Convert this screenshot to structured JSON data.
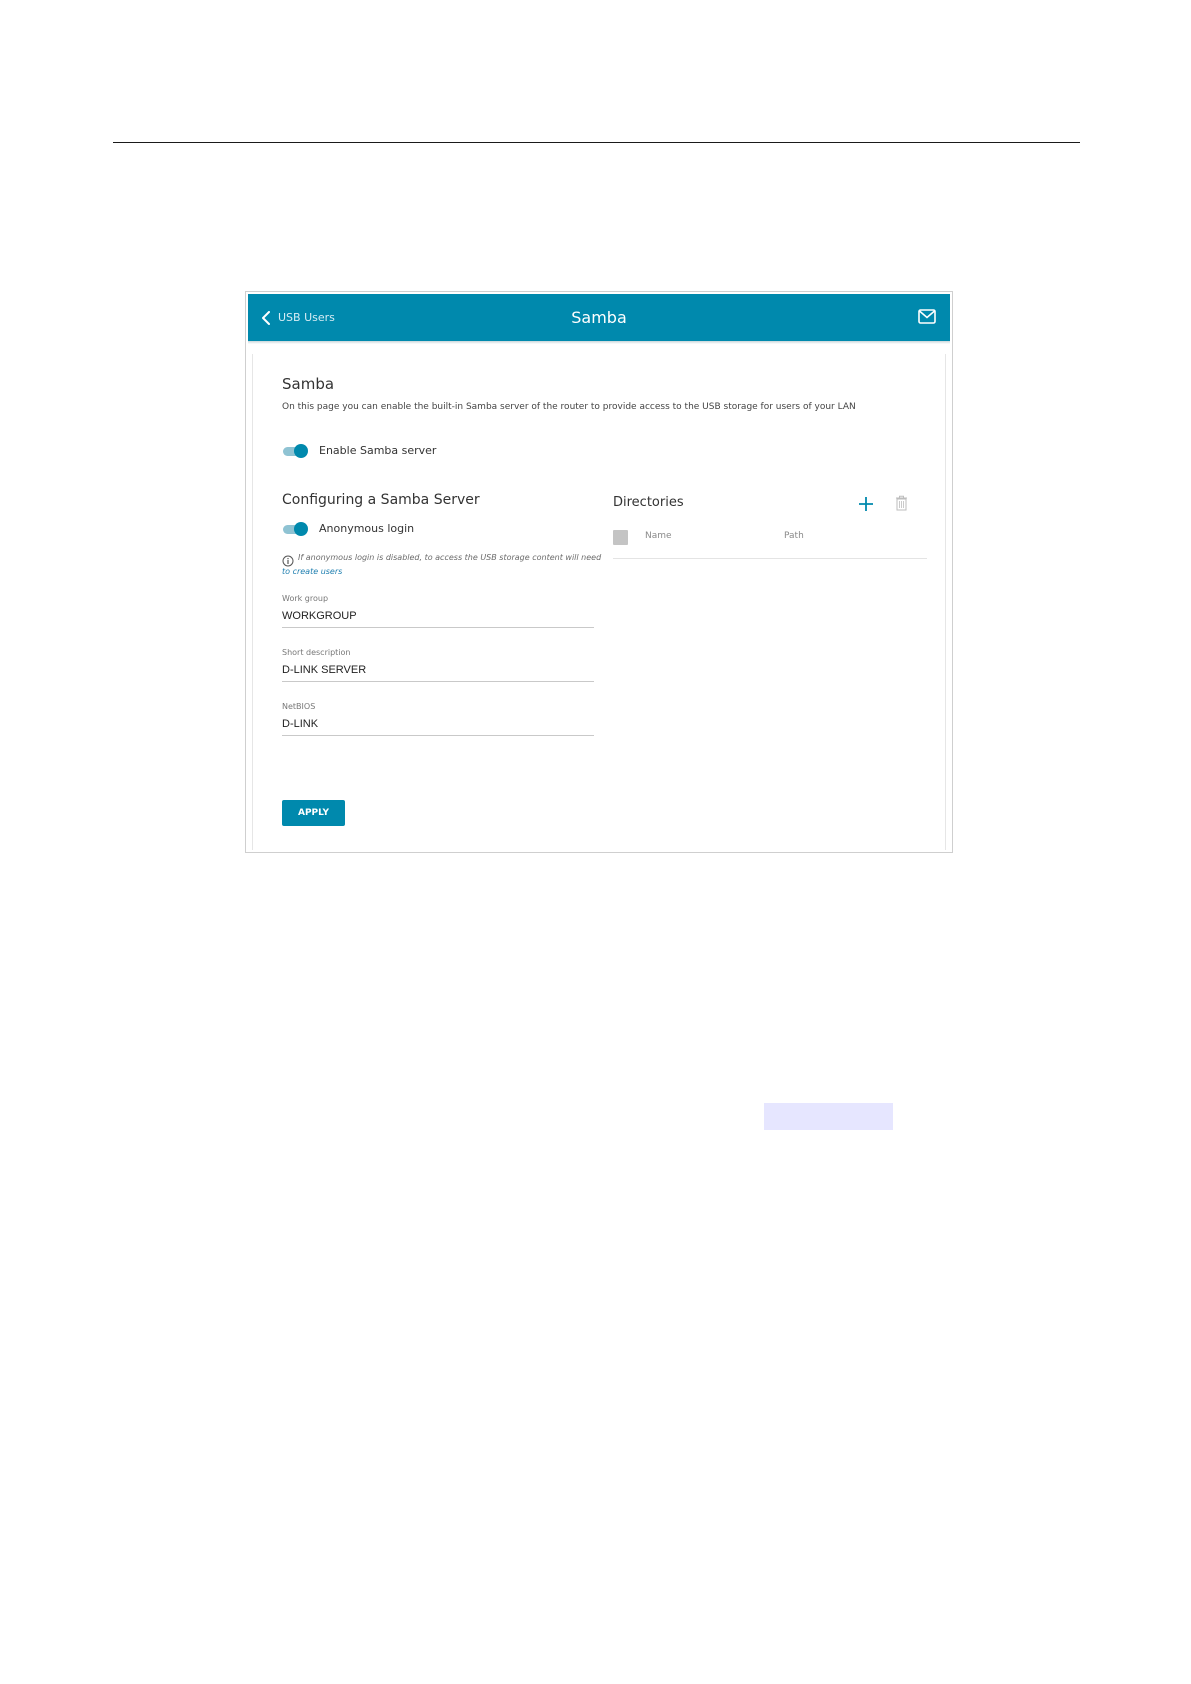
{
  "header": {
    "back_label": "USB Users",
    "title": "Samba",
    "accent_color": "#0089ad"
  },
  "samba": {
    "title": "Samba",
    "description": "On this page you can enable the built-in Samba server of the router to provide access to the USB storage for users of your LAN",
    "enable_toggle": {
      "label": "Enable Samba server",
      "state": "on"
    }
  },
  "config": {
    "title": "Configuring a Samba Server",
    "anonymous_toggle": {
      "label": "Anonymous login",
      "state": "on"
    },
    "hint_text": "If anonymous login is disabled, to access the USB storage content will need",
    "hint_link": "to create users",
    "fields": {
      "work_group": {
        "label": "Work group",
        "value": "WORKGROUP"
      },
      "short_description": {
        "label": "Short description",
        "value": "D-LINK SERVER"
      },
      "netbios": {
        "label": "NetBIOS",
        "value": "D-LINK"
      }
    },
    "apply_label": "APPLY"
  },
  "directories": {
    "title": "Directories",
    "columns": {
      "name": "Name",
      "path": "Path"
    }
  },
  "icons": {
    "back": "chevron-left-icon",
    "mail": "mail-icon",
    "info": "info-icon",
    "add": "plus-icon",
    "delete": "trash-icon"
  }
}
